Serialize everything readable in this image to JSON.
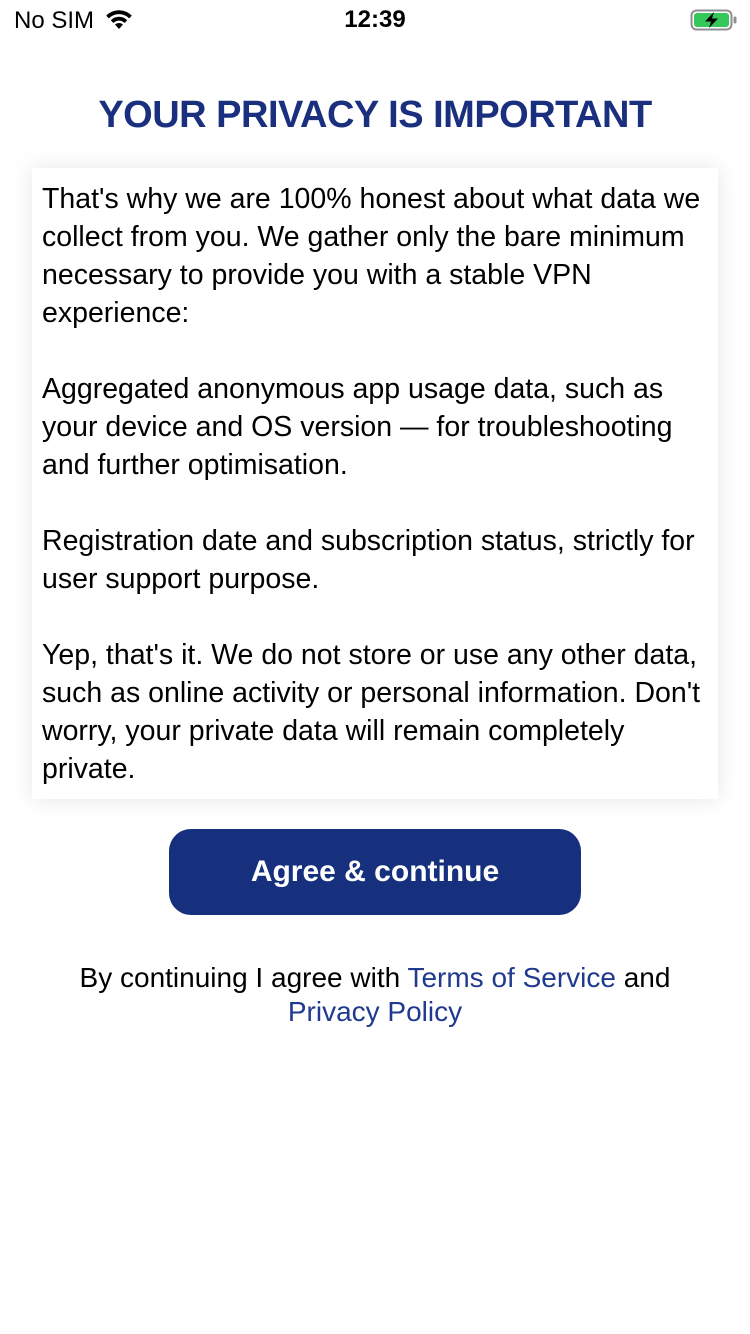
{
  "status_bar": {
    "carrier": "No SIM",
    "time": "12:39",
    "wifi_icon": "wifi-icon",
    "battery_icon": "battery-charging-icon",
    "battery_color": "#34c759"
  },
  "title": "YOUR PRIVACY IS IMPORTANT",
  "body": {
    "paragraphs": [
      "That's why we are 100% honest about what data we collect from you. We gather only the bare minimum necessary to provide you with a stable VPN experience:",
      "Aggregated anonymous app usage data, such as your device and OS version — for troubleshooting and further optimisation.",
      "Registration date and subscription status, strictly for user support purpose.",
      "Yep, that's it. We do not store or use any other data, such as online activity or personal information. Don't worry, your private data will remain completely private."
    ]
  },
  "agree_button": {
    "label": "Agree & continue"
  },
  "legal": {
    "prefix": "By continuing I agree with ",
    "terms_link": "Terms of Service",
    "conjunction": " and",
    "privacy_link": "Privacy Policy"
  },
  "colors": {
    "accent": "#16307d",
    "title": "#1a2f7e",
    "link": "#1f3a8f"
  }
}
